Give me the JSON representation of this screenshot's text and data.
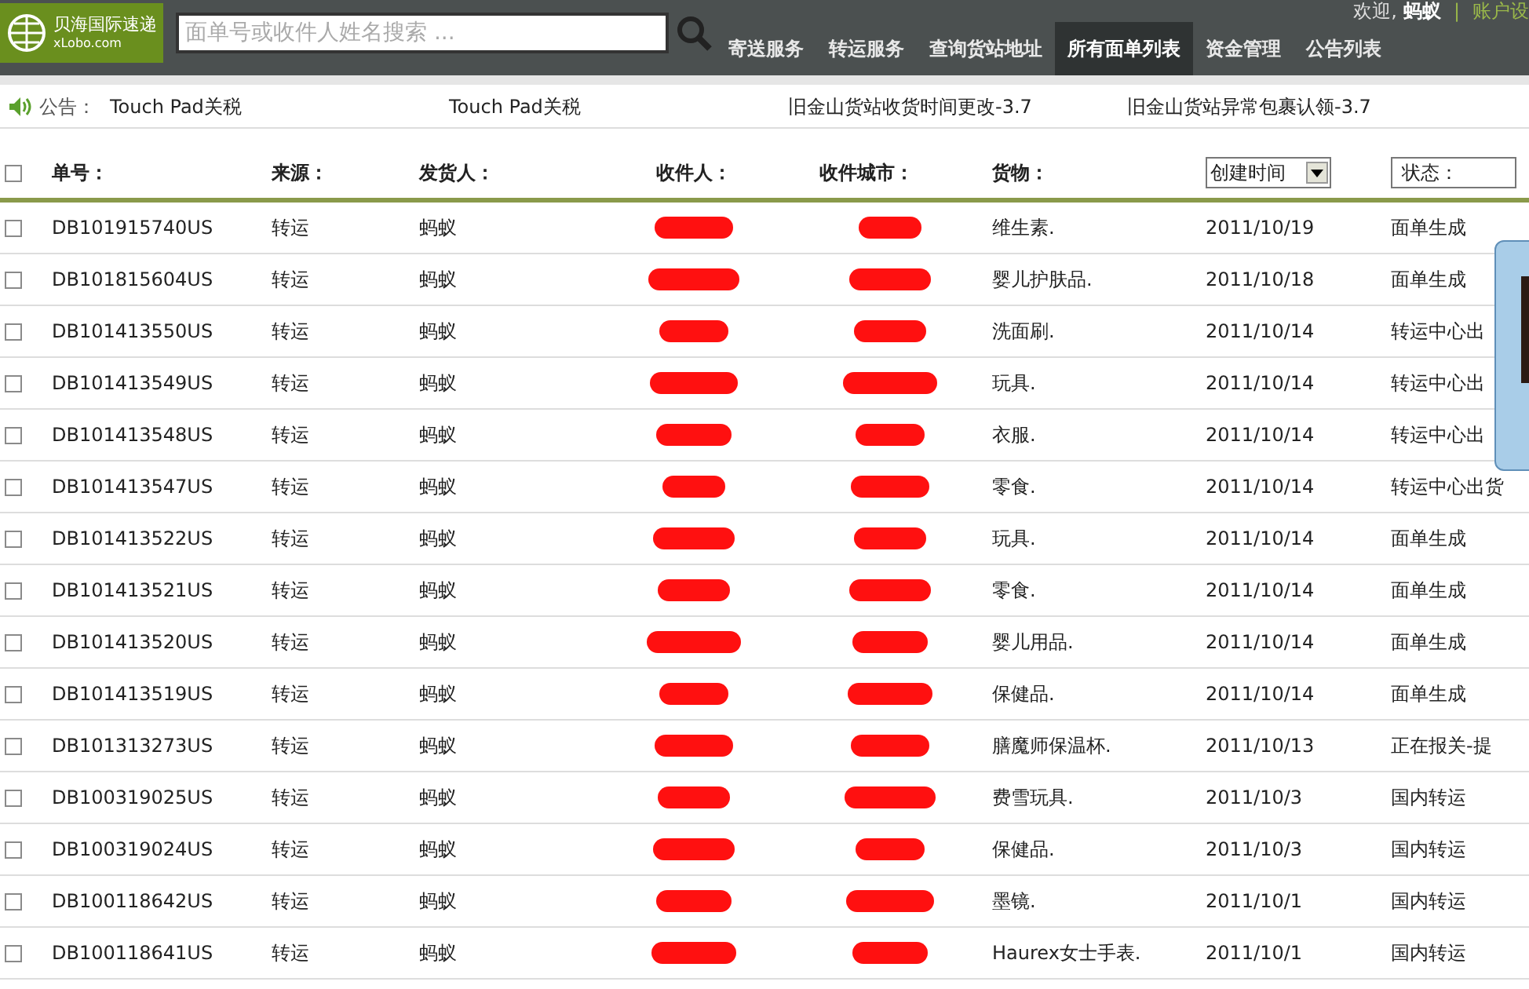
{
  "header": {
    "logo": {
      "name": "贝海国际速递",
      "domain": "xLobo.com"
    },
    "search": {
      "placeholder": "面单号或收件人姓名搜索 ..."
    },
    "welcome": "欢迎,",
    "user": "蚂蚁",
    "separator": "|",
    "account": "账户设",
    "nav": [
      {
        "label": "寄送服务",
        "selected": false
      },
      {
        "label": "转运服务",
        "selected": false
      },
      {
        "label": "查询货站地址",
        "selected": false
      },
      {
        "label": "所有面单列表",
        "selected": true
      },
      {
        "label": "资金管理",
        "selected": false
      },
      {
        "label": "公告列表",
        "selected": false
      }
    ]
  },
  "notices": {
    "label": "公告：",
    "items": [
      "Touch Pad关税",
      "Touch Pad关税",
      "旧金山货站收货时间更改-3.7",
      "旧金山货站异常包裹认领-3.7"
    ]
  },
  "table": {
    "select_all": {
      "checked": false
    },
    "columns": [
      "单号：",
      "来源：",
      "发货人：",
      "收件人：",
      "收件城市：",
      "货物："
    ],
    "sort": {
      "value": "创建时间"
    },
    "status_filter": {
      "value": "状态："
    },
    "rows": [
      {
        "checked": false,
        "id": "DB101915740US",
        "source": "转运",
        "sender": "蚂蚁",
        "goods": "维生素.",
        "date": "2011/10/19",
        "status": "面单生成"
      },
      {
        "checked": false,
        "id": "DB101815604US",
        "source": "转运",
        "sender": "蚂蚁",
        "goods": "婴儿护肤品.",
        "date": "2011/10/18",
        "status": "面单生成"
      },
      {
        "checked": false,
        "id": "DB101413550US",
        "source": "转运",
        "sender": "蚂蚁",
        "goods": "洗面刷.",
        "date": "2011/10/14",
        "status": "转运中心出"
      },
      {
        "checked": false,
        "id": "DB101413549US",
        "source": "转运",
        "sender": "蚂蚁",
        "goods": "玩具.",
        "date": "2011/10/14",
        "status": "转运中心出"
      },
      {
        "checked": false,
        "id": "DB101413548US",
        "source": "转运",
        "sender": "蚂蚁",
        "goods": "衣服.",
        "date": "2011/10/14",
        "status": "转运中心出"
      },
      {
        "checked": false,
        "id": "DB101413547US",
        "source": "转运",
        "sender": "蚂蚁",
        "goods": "零食.",
        "date": "2011/10/14",
        "status": "转运中心出货"
      },
      {
        "checked": false,
        "id": "DB101413522US",
        "source": "转运",
        "sender": "蚂蚁",
        "goods": "玩具.",
        "date": "2011/10/14",
        "status": "面单生成"
      },
      {
        "checked": false,
        "id": "DB101413521US",
        "source": "转运",
        "sender": "蚂蚁",
        "goods": "零食.",
        "date": "2011/10/14",
        "status": "面单生成"
      },
      {
        "checked": false,
        "id": "DB101413520US",
        "source": "转运",
        "sender": "蚂蚁",
        "goods": "婴儿用品.",
        "date": "2011/10/14",
        "status": "面单生成"
      },
      {
        "checked": false,
        "id": "DB101413519US",
        "source": "转运",
        "sender": "蚂蚁",
        "goods": "保健品.",
        "date": "2011/10/14",
        "status": "面单生成"
      },
      {
        "checked": false,
        "id": "DB101313273US",
        "source": "转运",
        "sender": "蚂蚁",
        "goods": "膳魔师保温杯.",
        "date": "2011/10/13",
        "status": "正在报关-提"
      },
      {
        "checked": false,
        "id": "DB100319025US",
        "source": "转运",
        "sender": "蚂蚁",
        "goods": "费雪玩具.",
        "date": "2011/10/3",
        "status": "国内转运"
      },
      {
        "checked": false,
        "id": "DB100319024US",
        "source": "转运",
        "sender": "蚂蚁",
        "goods": "保健品.",
        "date": "2011/10/3",
        "status": "国内转运"
      },
      {
        "checked": false,
        "id": "DB100118642US",
        "source": "转运",
        "sender": "蚂蚁",
        "goods": "墨镜.",
        "date": "2011/10/1",
        "status": "国内转运"
      },
      {
        "checked": false,
        "id": "DB100118641US",
        "source": "转运",
        "sender": "蚂蚁",
        "goods": "Haurex女士手表.",
        "date": "2011/10/1",
        "status": "国内转运"
      }
    ]
  }
}
